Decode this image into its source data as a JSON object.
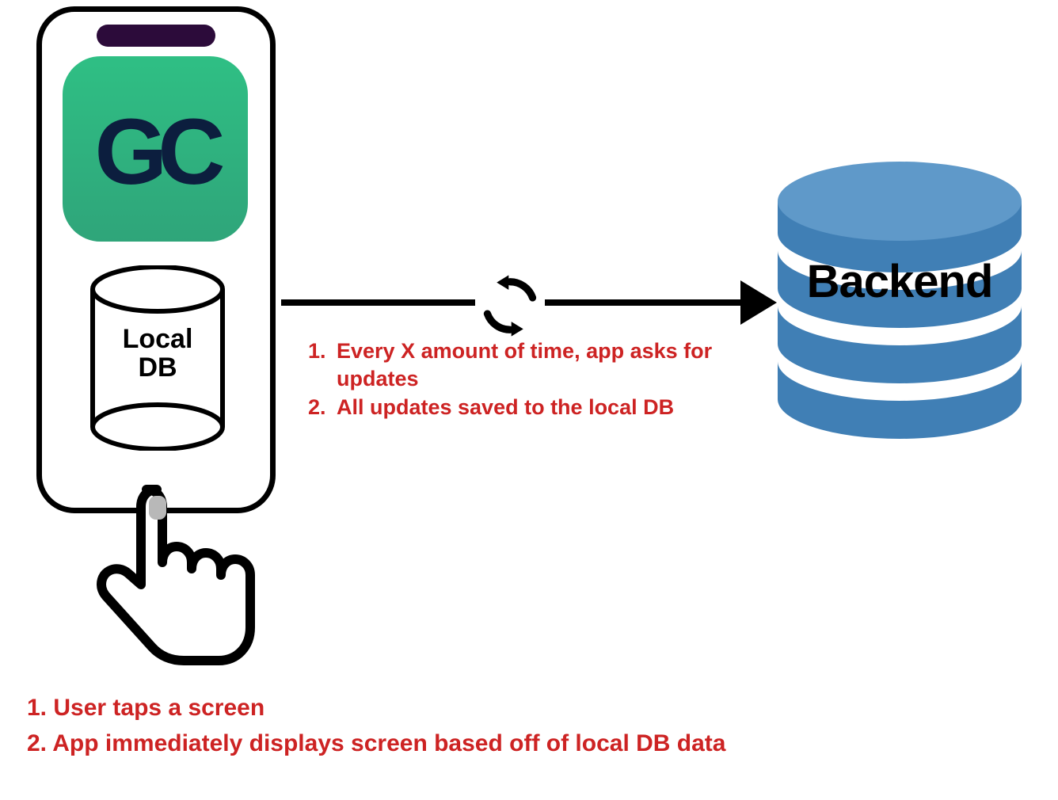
{
  "colors": {
    "accent_red": "#cd2323",
    "icon_green_top": "#2fbf84",
    "icon_green_bottom": "#2fa57a",
    "db_blue": "#407fb5",
    "db_blue_top": "#5f99c9",
    "notch": "#2c0b3a",
    "gc_text": "#0c1e3e"
  },
  "phone": {
    "app_initials": "GC",
    "local_db_label_line1": "Local",
    "local_db_label_line2": "DB"
  },
  "backend": {
    "label": "Backend"
  },
  "sync_steps": {
    "items": [
      "Every X amount of time, app asks for updates",
      "All updates saved to the local DB"
    ]
  },
  "user_steps": {
    "items": [
      "1. User taps a screen",
      "2. App immediately displays screen based off of local DB data"
    ]
  }
}
